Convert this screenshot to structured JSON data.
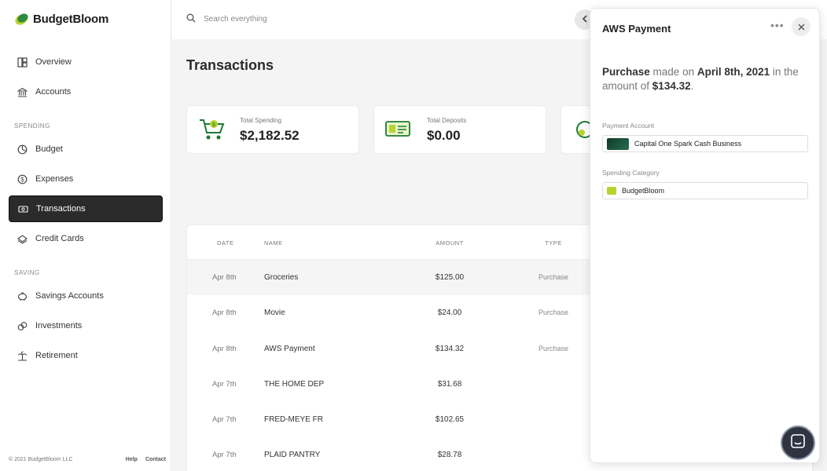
{
  "app": {
    "name": "BudgetBloom"
  },
  "sidebar": {
    "overview": "Overview",
    "accounts": "Accounts",
    "spending_label": "SPENDING",
    "budget": "Budget",
    "expenses": "Expenses",
    "transactions": "Transactions",
    "credit_cards": "Credit Cards",
    "saving_label": "SAVING",
    "savings_accounts": "Savings Accounts",
    "investments": "Investments",
    "retirement": "Retirement"
  },
  "footer": {
    "copyright": "© 2021 BudgetBloom LLC",
    "help": "Help",
    "contact": "Contact"
  },
  "search": {
    "placeholder": "Search everything"
  },
  "page": {
    "title": "Transactions"
  },
  "stats": [
    {
      "label": "Total Spending",
      "value": "$2,182.52"
    },
    {
      "label": "Total Deposits",
      "value": "$0.00"
    }
  ],
  "table": {
    "headers": {
      "date": "DATE",
      "name": "NAME",
      "amount": "AMOUNT",
      "type": "TYPE"
    },
    "rows": [
      {
        "date": "Apr 8th",
        "name": "Groceries",
        "amount": "$125.00",
        "type": "Purchase"
      },
      {
        "date": "Apr 8th",
        "name": "Movie",
        "amount": "$24.00",
        "type": "Purchase"
      },
      {
        "date": "Apr 8th",
        "name": "AWS Payment",
        "amount": "$134.32",
        "type": "Purchase"
      },
      {
        "date": "Apr 7th",
        "name": "THE HOME DEP",
        "amount": "$31.68",
        "type": ""
      },
      {
        "date": "Apr 7th",
        "name": "FRED-MEYE FR",
        "amount": "$102.65",
        "type": ""
      },
      {
        "date": "Apr 7th",
        "name": "PLAID PANTRY",
        "amount": "$28.78",
        "type": ""
      }
    ]
  },
  "panel": {
    "title": "AWS Payment",
    "desc": {
      "type": "Purchase",
      "made_on": " made on ",
      "date": "April 8th, 2021",
      "in_the_amount": " in the amount of ",
      "amount": "$134.32",
      "end": "."
    },
    "payment_account_label": "Payment Account",
    "payment_account": "Capital One Spark Cash Business",
    "spending_category_label": "Spending Category",
    "spending_category": "BudgetBloom"
  },
  "colors": {
    "accent": "#2b2b2b",
    "brand_green": "#2e8b3a",
    "brand_lime": "#b6d32e"
  }
}
